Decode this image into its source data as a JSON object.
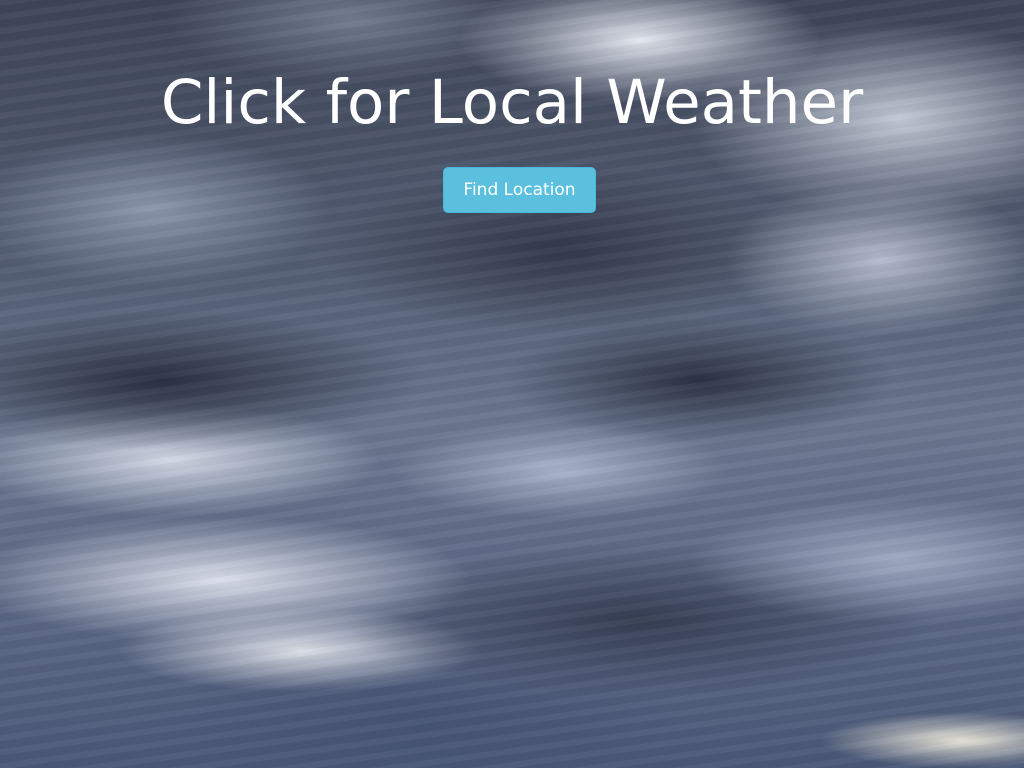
{
  "page": {
    "heading": "Click for Local Weather"
  },
  "actions": {
    "find_location_label": "Find Location"
  },
  "background": {
    "icon": "storm-clouds-image"
  },
  "colors": {
    "button_bg": "#5bc0de",
    "button_border": "#46b8da",
    "text": "#ffffff"
  }
}
